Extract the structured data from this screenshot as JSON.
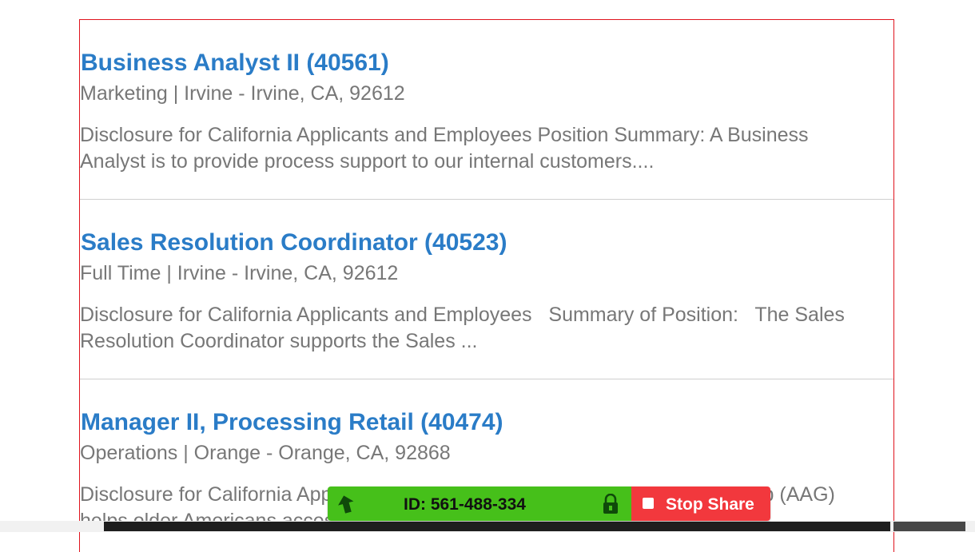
{
  "jobs": [
    {
      "title": "Business Analyst II (40561)",
      "meta": "Marketing | Irvine - Irvine, CA, 92612",
      "description": "Disclosure for California Applicants and Employees Position Summary: A Business Analyst is to provide process support to our internal customers...."
    },
    {
      "title": "Sales Resolution Coordinator (40523)",
      "meta": "Full Time | Irvine - Irvine, CA, 92612",
      "description": "Disclosure for California Applicants and Employees   Summary of Position:   The Sales Resolution Coordinator supports the Sales ..."
    },
    {
      "title": "Manager II, Processing Retail (40474)",
      "meta": "Operations | Orange - Orange, CA, 92868",
      "description": "Disclosure for California Applicants and Employees   American Advisors Group (AAG) helps older Americans access..."
    }
  ],
  "share_toolbar": {
    "meeting_id": "ID: 561-488-334",
    "stop_label": "Stop Share",
    "expand_icon": "expand-arrow-icon",
    "lock_icon": "lock-icon",
    "colors": {
      "bar": "#46c01a",
      "stop": "#f2383d",
      "link": "#2a7cc7",
      "frame_border": "#e0141e"
    }
  }
}
